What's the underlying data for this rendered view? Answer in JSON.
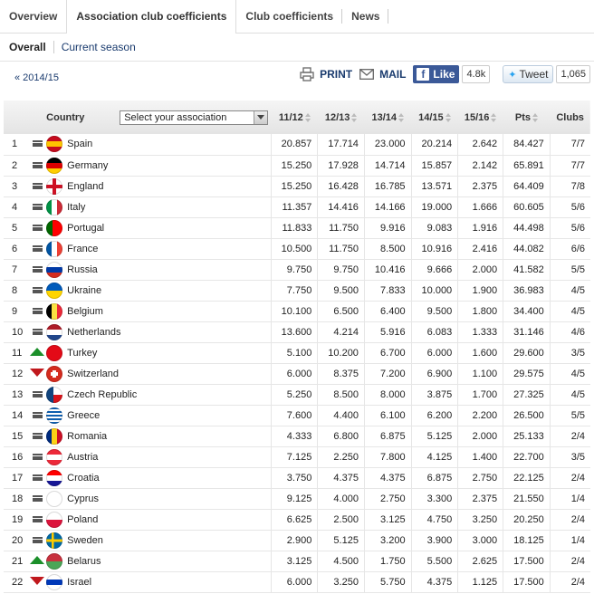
{
  "tabs": [
    "Overview",
    "Association club coefficients",
    "Club coefficients",
    "News"
  ],
  "subnav": [
    "Overall",
    "Current season"
  ],
  "toolbar": {
    "prev": "« 2014/15",
    "print": "PRINT",
    "mail": "MAIL",
    "like": "Like",
    "like_count": "4.8k",
    "tweet": "Tweet",
    "tweet_count": "1,065"
  },
  "table": {
    "headers": {
      "country": "Country",
      "select_placeholder": "Select your association",
      "c1": "11/12",
      "c2": "12/13",
      "c3": "13/14",
      "c4": "14/15",
      "c5": "15/16",
      "pts": "Pts",
      "clubs": "Clubs"
    },
    "rows": [
      {
        "rank": "1",
        "trend": "same",
        "country": "Spain",
        "flag": [
          "#c60b1e",
          "#ffc400",
          "#c60b1e"
        ],
        "v": [
          "20.857",
          "17.714",
          "23.000",
          "20.214",
          "2.642",
          "84.427",
          "7/7"
        ]
      },
      {
        "rank": "2",
        "trend": "same",
        "country": "Germany",
        "flag": [
          "#000000",
          "#dd0000",
          "#ffce00"
        ],
        "v": [
          "15.250",
          "17.928",
          "14.714",
          "15.857",
          "2.142",
          "65.891",
          "7/7"
        ]
      },
      {
        "rank": "3",
        "trend": "same",
        "country": "England",
        "flag": [
          "cross",
          "#ffffff",
          "#ce1124"
        ],
        "v": [
          "15.250",
          "16.428",
          "16.785",
          "13.571",
          "2.375",
          "64.409",
          "7/8"
        ]
      },
      {
        "rank": "4",
        "trend": "same",
        "country": "Italy",
        "flag": [
          "v",
          "#009246",
          "#ffffff",
          "#ce2b37"
        ],
        "v": [
          "11.357",
          "14.416",
          "14.166",
          "19.000",
          "1.666",
          "60.605",
          "5/6"
        ]
      },
      {
        "rank": "5",
        "trend": "same",
        "country": "Portugal",
        "flag": [
          "v2",
          "#006600",
          "#ff0000"
        ],
        "v": [
          "11.833",
          "11.750",
          "9.916",
          "9.083",
          "1.916",
          "44.498",
          "5/6"
        ]
      },
      {
        "rank": "6",
        "trend": "same",
        "country": "France",
        "flag": [
          "v",
          "#0055a4",
          "#ffffff",
          "#ef4135"
        ],
        "v": [
          "10.500",
          "11.750",
          "8.500",
          "10.916",
          "2.416",
          "44.082",
          "6/6"
        ]
      },
      {
        "rank": "7",
        "trend": "same",
        "country": "Russia",
        "flag": [
          "#ffffff",
          "#0039a6",
          "#d52b1e"
        ],
        "v": [
          "9.750",
          "9.750",
          "10.416",
          "9.666",
          "2.000",
          "41.582",
          "5/5"
        ]
      },
      {
        "rank": "8",
        "trend": "same",
        "country": "Ukraine",
        "flag": [
          "#005bbb",
          "#ffd500"
        ],
        "v": [
          "7.750",
          "9.500",
          "7.833",
          "10.000",
          "1.900",
          "36.983",
          "4/5"
        ]
      },
      {
        "rank": "9",
        "trend": "same",
        "country": "Belgium",
        "flag": [
          "v",
          "#000000",
          "#fae042",
          "#ed2939"
        ],
        "v": [
          "10.100",
          "6.500",
          "6.400",
          "9.500",
          "1.800",
          "34.400",
          "4/5"
        ]
      },
      {
        "rank": "10",
        "trend": "same",
        "country": "Netherlands",
        "flag": [
          "#ae1c28",
          "#ffffff",
          "#21468b"
        ],
        "v": [
          "13.600",
          "4.214",
          "5.916",
          "6.083",
          "1.333",
          "31.146",
          "4/6"
        ]
      },
      {
        "rank": "11",
        "trend": "up",
        "country": "Turkey",
        "flag": [
          "solid",
          "#e30a17"
        ],
        "v": [
          "5.100",
          "10.200",
          "6.700",
          "6.000",
          "1.600",
          "29.600",
          "3/5"
        ]
      },
      {
        "rank": "12",
        "trend": "down",
        "country": "Switzerland",
        "flag": [
          "swiss",
          "#d52b1e"
        ],
        "v": [
          "6.000",
          "8.375",
          "7.200",
          "6.900",
          "1.100",
          "29.575",
          "4/5"
        ]
      },
      {
        "rank": "13",
        "trend": "same",
        "country": "Czech Republic",
        "flag": [
          "czech",
          "#ffffff",
          "#d7141a",
          "#11457e"
        ],
        "v": [
          "5.250",
          "8.500",
          "8.000",
          "3.875",
          "1.700",
          "27.325",
          "4/5"
        ]
      },
      {
        "rank": "14",
        "trend": "same",
        "country": "Greece",
        "flag": [
          "greece",
          "#0d5eaf",
          "#ffffff"
        ],
        "v": [
          "7.600",
          "4.400",
          "6.100",
          "6.200",
          "2.200",
          "26.500",
          "5/5"
        ]
      },
      {
        "rank": "15",
        "trend": "same",
        "country": "Romania",
        "flag": [
          "v",
          "#002b7f",
          "#fcd116",
          "#ce1126"
        ],
        "v": [
          "4.333",
          "6.800",
          "6.875",
          "5.125",
          "2.000",
          "25.133",
          "2/4"
        ]
      },
      {
        "rank": "16",
        "trend": "same",
        "country": "Austria",
        "flag": [
          "#ed2939",
          "#ffffff",
          "#ed2939"
        ],
        "v": [
          "7.125",
          "2.250",
          "7.800",
          "4.125",
          "1.400",
          "22.700",
          "3/5"
        ]
      },
      {
        "rank": "17",
        "trend": "same",
        "country": "Croatia",
        "flag": [
          "#ff0000",
          "#ffffff",
          "#171796"
        ],
        "v": [
          "3.750",
          "4.375",
          "4.375",
          "6.875",
          "2.750",
          "22.125",
          "2/4"
        ]
      },
      {
        "rank": "18",
        "trend": "same",
        "country": "Cyprus",
        "flag": [
          "solid",
          "#ffffff"
        ],
        "v": [
          "9.125",
          "4.000",
          "2.750",
          "3.300",
          "2.375",
          "21.550",
          "1/4"
        ]
      },
      {
        "rank": "19",
        "trend": "same",
        "country": "Poland",
        "flag": [
          "#ffffff",
          "#dc143c"
        ],
        "v": [
          "6.625",
          "2.500",
          "3.125",
          "4.750",
          "3.250",
          "20.250",
          "2/4"
        ]
      },
      {
        "rank": "20",
        "trend": "same",
        "country": "Sweden",
        "flag": [
          "sweden",
          "#006aa7",
          "#fecc00"
        ],
        "v": [
          "2.900",
          "5.125",
          "3.200",
          "3.900",
          "3.000",
          "18.125",
          "1/4"
        ]
      },
      {
        "rank": "21",
        "trend": "up",
        "country": "Belarus",
        "flag": [
          "#c8313e",
          "#4aa657"
        ],
        "v": [
          "3.125",
          "4.500",
          "1.750",
          "5.500",
          "2.625",
          "17.500",
          "2/4"
        ]
      },
      {
        "rank": "22",
        "trend": "down",
        "country": "Israel",
        "flag": [
          "#ffffff",
          "#0038b8",
          "#ffffff"
        ],
        "v": [
          "6.000",
          "3.250",
          "5.750",
          "4.375",
          "1.125",
          "17.500",
          "2/4"
        ]
      }
    ]
  }
}
